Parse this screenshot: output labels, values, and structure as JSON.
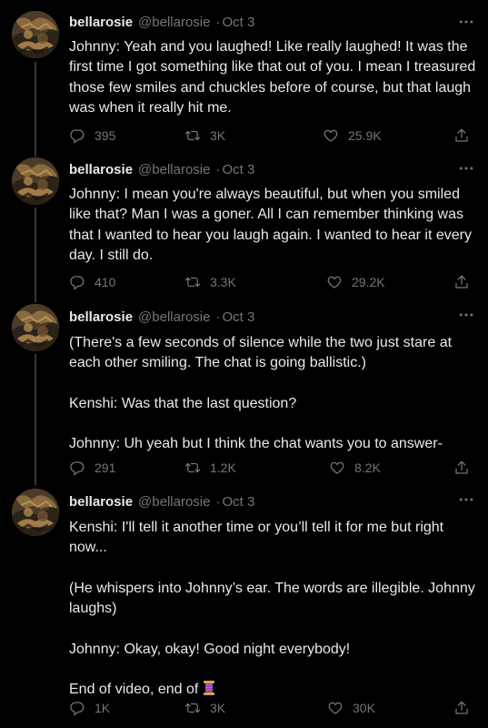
{
  "author": {
    "display_name": "bellarosie",
    "handle": "@bellarosie",
    "date": "Oct 3",
    "separator": "·"
  },
  "tweets": [
    {
      "text": "Johnny: Yeah and you laughed! Like really laughed! It was the first time I got something like that out of you. I mean I treasured those few smiles and chuckles before of course, but that laugh was when it really hit me.",
      "replies": "395",
      "retweets": "3K",
      "likes": "25.9K"
    },
    {
      "text": "Johnny: I mean you're always beautiful, but when you smiled like that? Man I was a goner. All I can remember thinking was that I wanted to hear you laugh again. I wanted to hear it every day. I still do.",
      "replies": "410",
      "retweets": "3.3K",
      "likes": "29.2K"
    },
    {
      "text": "(There's a few seconds of silence while the two just stare at each other smiling. The chat is going ballistic.)\n\nKenshi: Was that the last question?\n\nJohnny: Uh yeah but I think the chat wants you to answer-",
      "replies": "291",
      "retweets": "1.2K",
      "likes": "8.2K"
    },
    {
      "text": "Kenshi: I'll tell it another time or you’ll tell it for me but right now...\n\n(He whispers into Johnny’s ear. The words are illegible. Johnny laughs)\n\nJohnny: Okay, okay! Good night everybody!\n\nEnd of video, end of ",
      "emoji": "spool-of-thread",
      "replies": "1K",
      "retweets": "3K",
      "likes": "30K"
    }
  ],
  "icons": {
    "reply": "reply-icon",
    "retweet": "retweet-icon",
    "like": "heart-icon",
    "share": "share-icon",
    "more": "more-icon"
  },
  "colors": {
    "background": "#000000",
    "text": "#e7e9ea",
    "muted": "#71767b",
    "thread_line": "#333639"
  }
}
